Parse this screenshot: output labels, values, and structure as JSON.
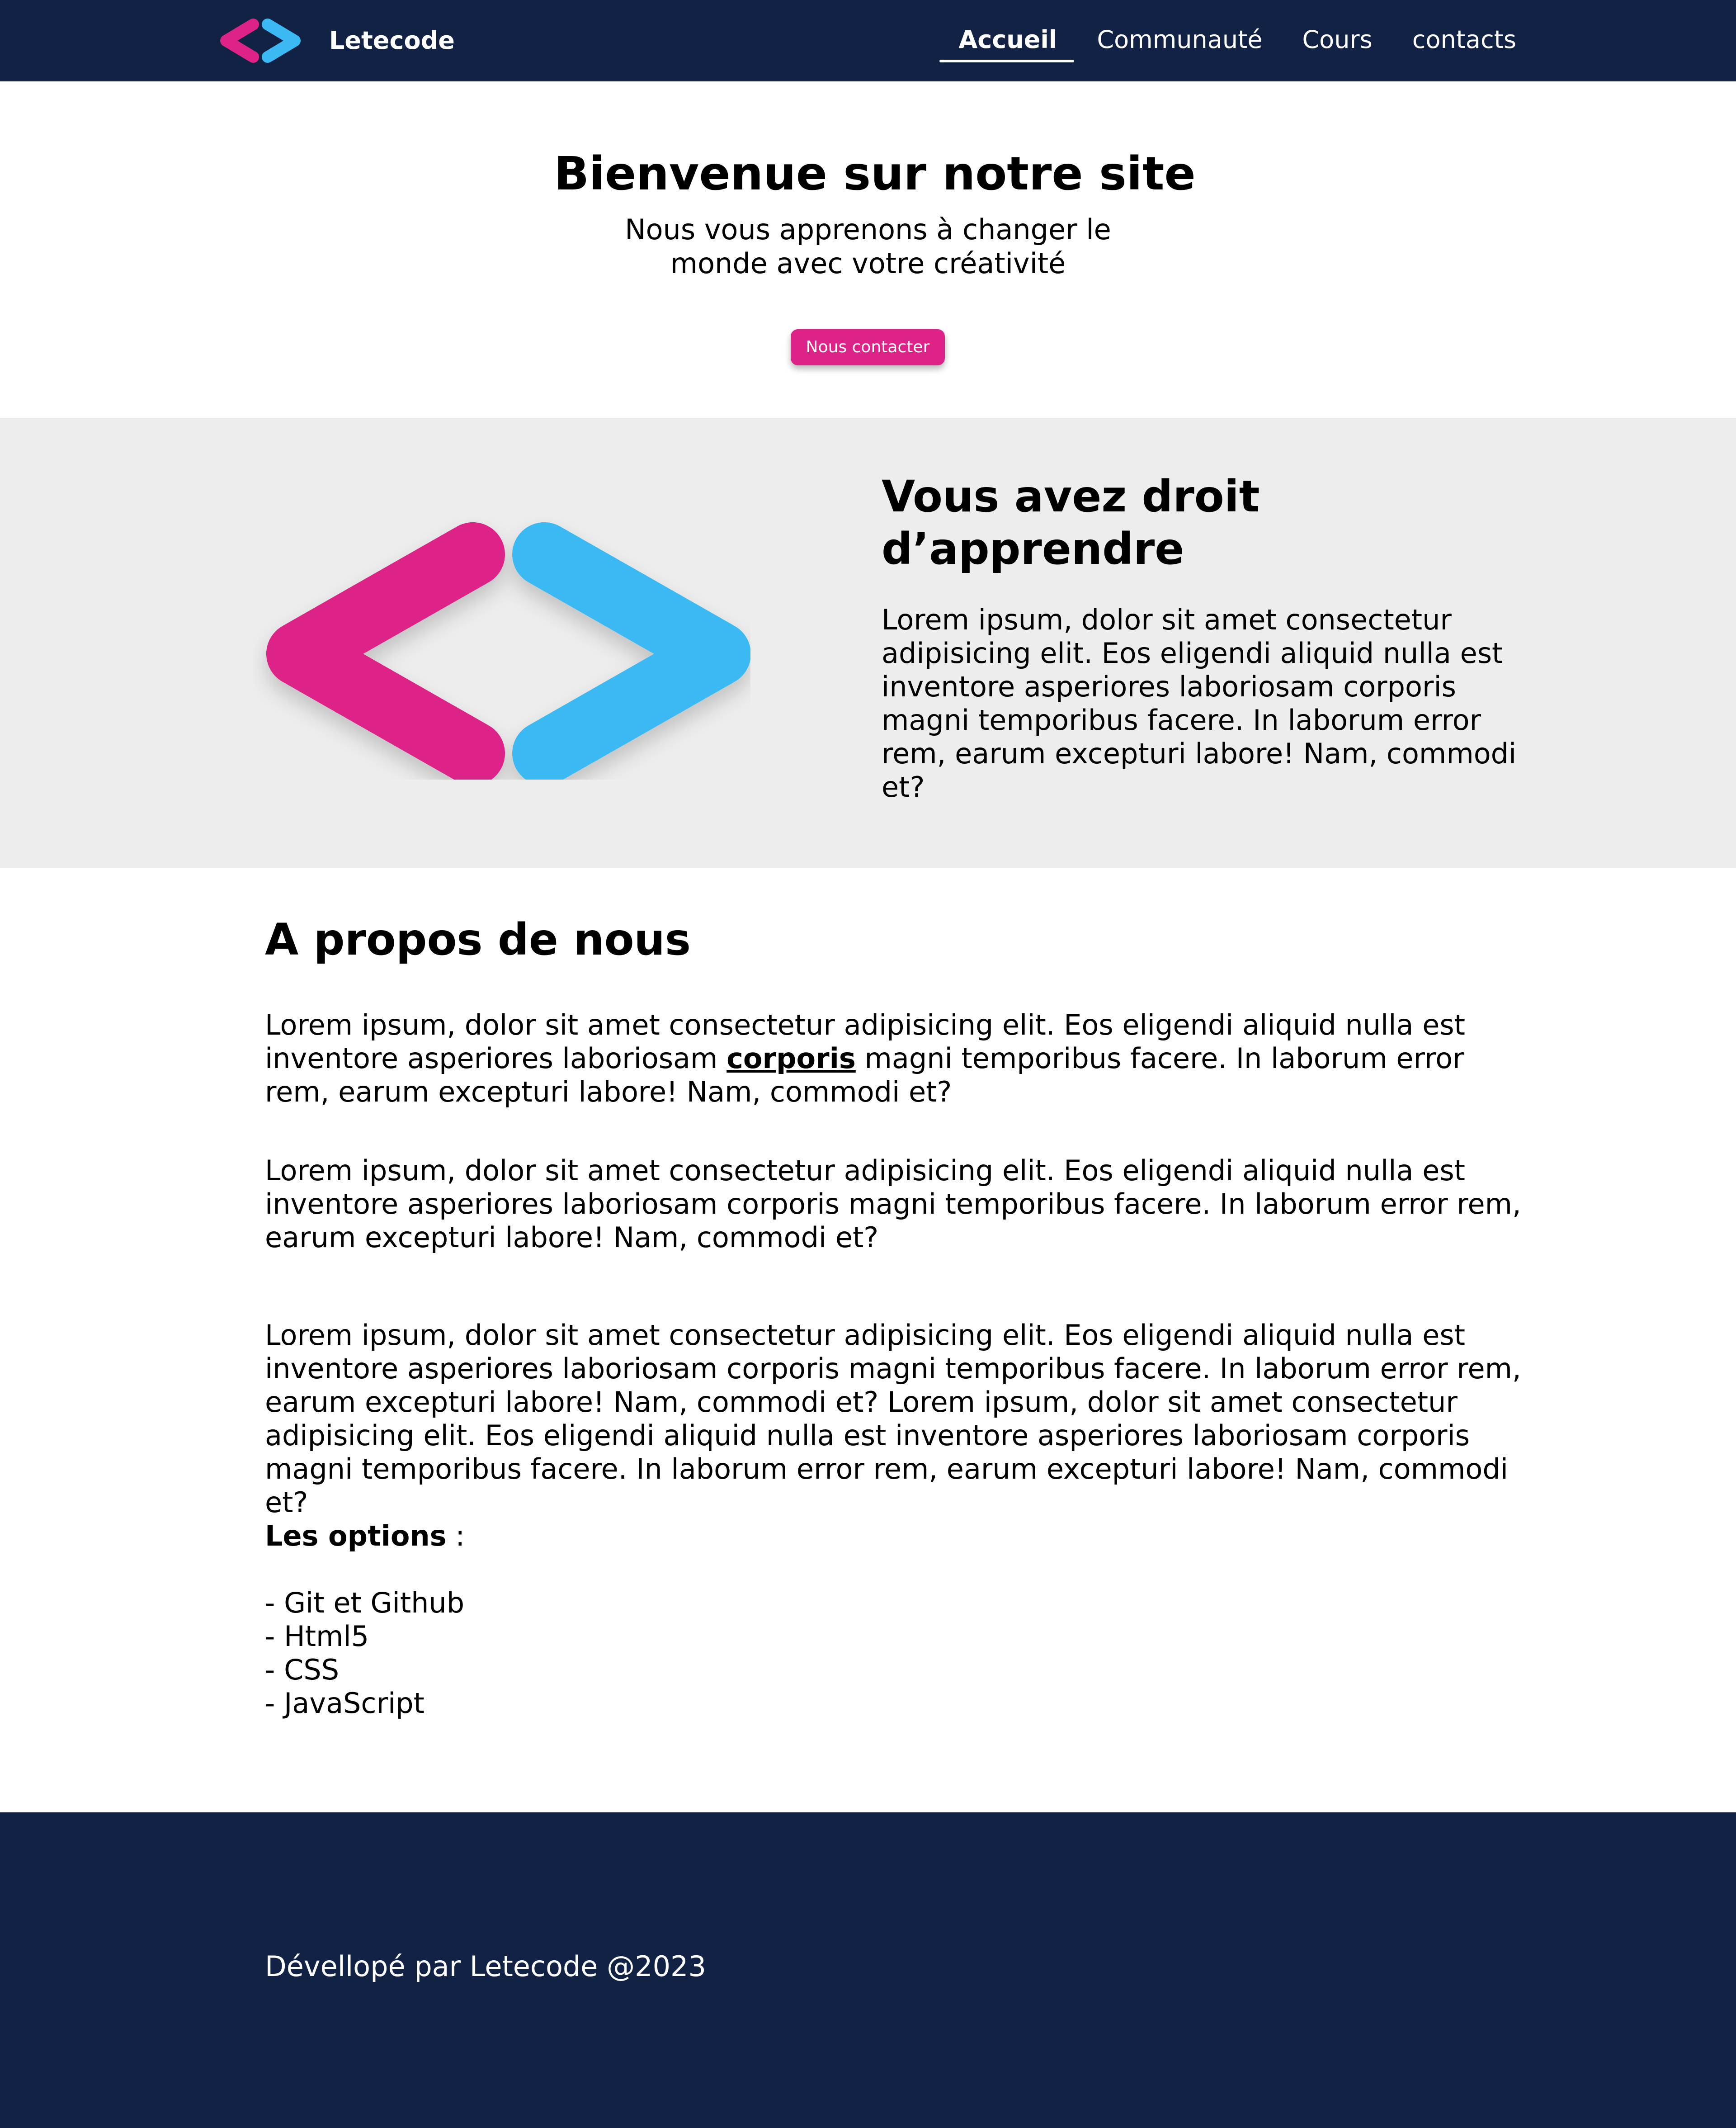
{
  "colors": {
    "navy": "#112244",
    "pink": "#dd2288",
    "blue": "#3bb9f2",
    "band_gray": "#ededed"
  },
  "navbar": {
    "brand": "Letecode",
    "logo_icon": "code-brackets-icon",
    "links": [
      {
        "label": "Accueil",
        "active": true
      },
      {
        "label": "Communauté",
        "active": false
      },
      {
        "label": "Cours",
        "active": false
      },
      {
        "label": "contacts",
        "active": false
      }
    ]
  },
  "hero": {
    "title": "Bienvenue sur notre site",
    "subtitle": "Nous vous apprenons à changer le monde avec votre créativité",
    "button_label": "Nous contacter"
  },
  "feature": {
    "logo_icon": "code-brackets-icon",
    "title": "Vous avez droit d’apprendre",
    "text": "Lorem ipsum, dolor sit amet consectetur adipisicing elit. Eos eligendi aliquid nulla est inventore asperiores laboriosam corporis magni temporibus facere. In laborum error rem, earum excepturi labore! Nam, commodi et?"
  },
  "about": {
    "title": "A propos de nous",
    "para1_before": "Lorem ipsum, dolor sit amet consectetur adipisicing elit. Eos eligendi aliquid nulla est inventore asperiores laboriosam ",
    "para1_link": "corporis",
    "para1_after": " magni temporibus facere. In laborum error rem, earum excepturi labore! Nam, commodi et?",
    "para2": "Lorem ipsum, dolor sit amet consectetur adipisicing elit. Eos eligendi aliquid nulla est inventore asperiores laboriosam corporis magni temporibus facere. In laborum error rem, earum excepturi labore! Nam, commodi et?",
    "para3": "Lorem ipsum, dolor sit amet consectetur adipisicing elit. Eos eligendi aliquid nulla est inventore asperiores laboriosam corporis magni temporibus facere. In laborum error rem, earum excepturi labore! Nam, commodi et? Lorem ipsum, dolor sit amet consectetur adipisicing elit. Eos eligendi aliquid nulla est inventore asperiores laboriosam corporis magni temporibus facere. In laborum error rem, earum excepturi labore! Nam, commodi et?",
    "options_label": "Les options",
    "options_suffix": " :",
    "options": [
      "Git et Github",
      "Html5",
      "CSS",
      "JavaScript"
    ]
  },
  "footer": {
    "text": "Dévellopé par Letecode @2023"
  }
}
